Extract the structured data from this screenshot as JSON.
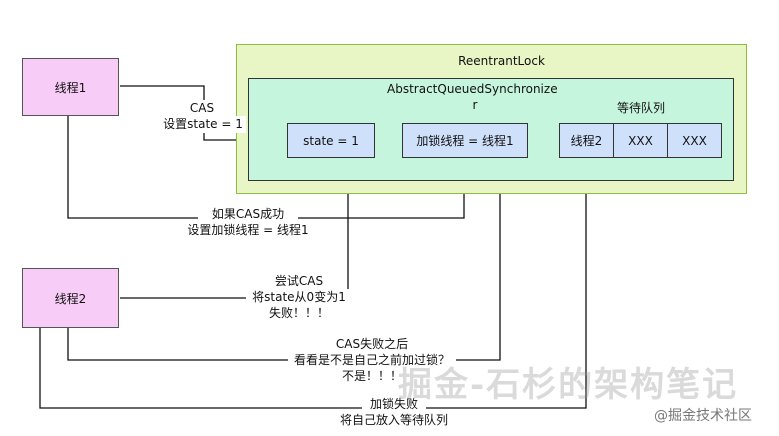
{
  "thread1": "线程1",
  "thread2": "线程2",
  "reentrant_lock": "ReentrantLock",
  "aqs_line1": "AbstractQueuedSynchronize",
  "aqs_line2": "r",
  "queue_title": "等待队列",
  "state_box": "state = 1",
  "lock_thread_box": "加锁线程 = 线程1",
  "queue_items": [
    "线程2",
    "XXX",
    "XXX"
  ],
  "cas_line1": "CAS",
  "cas_line2": "设置state = 1",
  "cas_success_line1": "如果CAS成功",
  "cas_success_line2": "设置加锁线程 = 线程1",
  "try_cas_line1": "尝试CAS",
  "try_cas_line2": "将state从0变为1",
  "try_cas_line3": "失败！！！",
  "cas_fail_line1": "CAS失败之后",
  "cas_fail_line2": "看看是不是自己之前加过锁？",
  "cas_fail_line3": "不是！！！",
  "lock_fail_line1": "加锁失败",
  "lock_fail_line2": "将自己放入等待队列",
  "watermark": "掘金-石杉的架构笔记",
  "footer": "@掘金技术社区",
  "colors": {
    "thread_fill": "#f7ccf7",
    "reentrant_fill": "#e8f5c4",
    "reentrant_border": "#8fbf3a",
    "aqs_fill": "#c6f5dd",
    "aqs_border": "#333333",
    "inner_fill": "#cfe0fb",
    "inner_border": "#333333"
  }
}
